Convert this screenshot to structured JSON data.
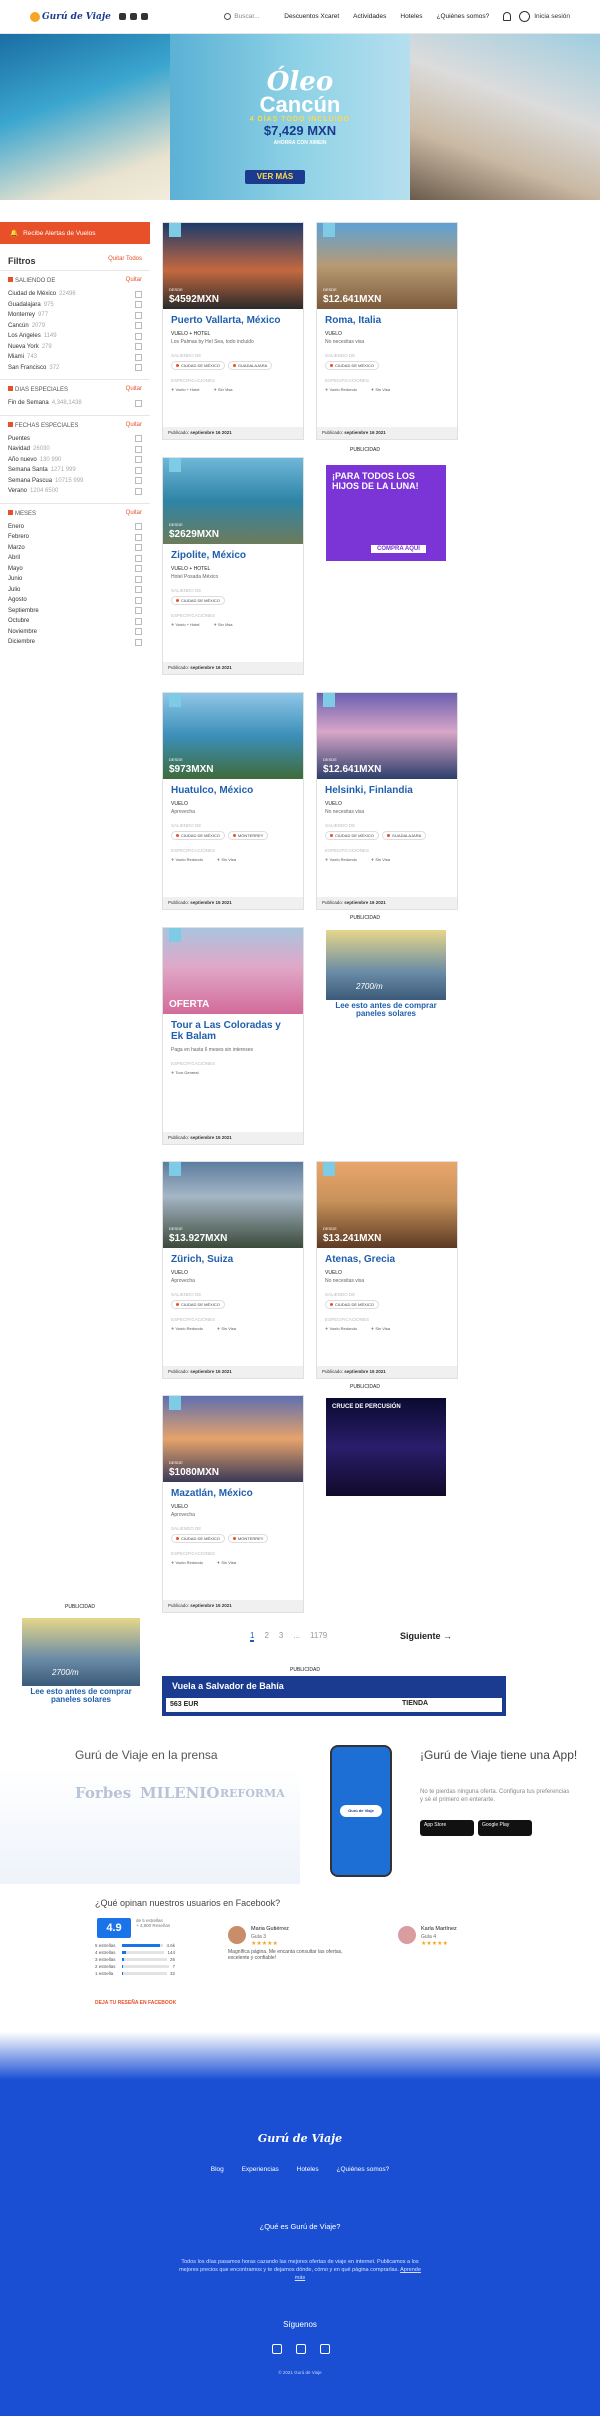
{
  "header": {
    "logo": "Gurú de Viaje",
    "search_placeholder": "Buscar...",
    "nav": [
      "Descuentos Xcaret",
      "Actividades",
      "Hoteles",
      "¿Quiénes somos?"
    ],
    "login": "Inicia sesión"
  },
  "hero": {
    "line1": "Óleo",
    "line2": "Cancún",
    "line3": "4 DÍAS TODO INCLUIDO",
    "price": "$7,429 MXN",
    "note": "AHORRA CON XIMEIN",
    "button": "VER MÁS"
  },
  "sidebar": {
    "alert_button": "Recibe Alertas de Vuelos",
    "filters_title": "Filtros",
    "clear_all": "Quitar Todos",
    "groups": [
      {
        "title": "SALIENDO DE",
        "clear": "Quitar",
        "items": [
          {
            "label": "Ciudad de México",
            "count": "22496"
          },
          {
            "label": "Guadalajara",
            "count": "975"
          },
          {
            "label": "Monterrey",
            "count": "977"
          },
          {
            "label": "Cancún",
            "count": "2079"
          },
          {
            "label": "Los Angeles",
            "count": "1149"
          },
          {
            "label": "Nueva York",
            "count": "279"
          },
          {
            "label": "Miami",
            "count": "743"
          },
          {
            "label": "San Francisco",
            "count": "372"
          }
        ]
      },
      {
        "title": "DIAS ESPECIALES",
        "clear": "Quitar",
        "items": [
          {
            "label": "Fin de Semana",
            "count": "4,348,1438"
          }
        ]
      },
      {
        "title": "FECHAS ESPECIALES",
        "clear": "Quitar",
        "items": [
          {
            "label": "Puentes",
            "count": ""
          },
          {
            "label": "Navidad",
            "count": "26030"
          },
          {
            "label": "Año nuevo",
            "count": "130 990"
          },
          {
            "label": "Semana Santa",
            "count": "1271 999"
          },
          {
            "label": "Semana Pascua",
            "count": "10715 999"
          },
          {
            "label": "Verano",
            "count": "1204 6500"
          }
        ]
      },
      {
        "title": "MESES",
        "clear": "Quitar",
        "items": [
          {
            "label": "Enero",
            "count": ""
          },
          {
            "label": "Febrero",
            "count": ""
          },
          {
            "label": "Marzo",
            "count": ""
          },
          {
            "label": "Abril",
            "count": ""
          },
          {
            "label": "Mayo",
            "count": ""
          },
          {
            "label": "Junio",
            "count": ""
          },
          {
            "label": "Julio",
            "count": ""
          },
          {
            "label": "Agosto",
            "count": ""
          },
          {
            "label": "Septiembre",
            "count": ""
          },
          {
            "label": "Octubre",
            "count": ""
          },
          {
            "label": "Noviembre",
            "count": ""
          },
          {
            "label": "Diciembre",
            "count": ""
          }
        ]
      }
    ]
  },
  "cards": [
    {
      "desde": "DESDE",
      "price": "$4592MXN",
      "title": "Puerto Vallarta, México",
      "sub": "VUELO + HOTEL",
      "desc": "Los Palmas by Hel Sea, todo incluido",
      "saliendo": "SALIENDO DE",
      "pills": [
        "CIUDAD DE MÉXICO",
        "GUADALAJARA"
      ],
      "esp": "ESPECIFICACIONES",
      "ic": [
        "Vuelo + Hotel",
        "Sin Visa"
      ],
      "date_label": "Publicado:",
      "date": "septiembre 16 2021",
      "bg": "linear-gradient(180deg,#1d3a6b 0%,#c4693f 55%,#2a2a2a 100%)"
    },
    {
      "desde": "DESDE",
      "price": "$12.641MXN",
      "title": "Roma, Italia",
      "sub": "VUELO",
      "desc": "No necesitas visa",
      "saliendo": "SALIENDO DE",
      "pills": [
        "CIUDAD DE MÉXICO"
      ],
      "esp": "ESPECIFICACIONES",
      "ic": [
        "Vuelo Redondo",
        "Sin Visa"
      ],
      "date_label": "Publicado:",
      "date": "septiembre 16 2021",
      "bg": "linear-gradient(180deg,#5da2d6 0%,#b89a72 50%,#7b5a3b 100%)"
    },
    {
      "desde": "DESDE",
      "price": "$2629MXN",
      "title": "Zipolite, México",
      "sub": "VUELO + HOTEL",
      "desc": "Hotel Posada México",
      "saliendo": "SALIENDO DE",
      "pills": [
        "CIUDAD DE MÉXICO"
      ],
      "esp": "ESPECIFICACIONES",
      "ic": [
        "Vuelo + Hotel",
        "Sin Visa"
      ],
      "date_label": "Publicado:",
      "date": "septiembre 16 2021",
      "bg": "linear-gradient(180deg,#6fb7d8 0%,#2e84a6 50%,#6d7b5a 100%)"
    },
    {
      "desde": "DESDE",
      "price": "$12.641MXN",
      "title": "Helsinki, Finlandia",
      "sub": "VUELO",
      "desc": "No necesitas visa",
      "saliendo": "SALIENDO DE",
      "pills": [
        "CIUDAD DE MÉXICO",
        "GUADALAJARA"
      ],
      "esp": "ESPECIFICACIONES",
      "ic": [
        "Vuelo Redondo",
        "Sin Visa"
      ],
      "date_label": "Publicado:",
      "date": "septiembre 16 2021",
      "bg": "linear-gradient(180deg,#6b5fb0 0%,#d8a6c8 45%,#2d3e6b 100%)"
    },
    {
      "desde": "DESDE",
      "price": "$973MXN",
      "title": "Huatulco, México",
      "sub": "VUELO",
      "desc": "Aprovecha",
      "saliendo": "SALIENDO DE",
      "pills": [
        "CIUDAD DE MÉXICO",
        "MONTERREY"
      ],
      "esp": "ESPECIFICACIONES",
      "ic": [
        "Vuelo Redondo",
        "Sin Visa"
      ],
      "date_label": "Publicado:",
      "date": "septiembre 15 2021",
      "bg": "linear-gradient(180deg,#8fc6e8 0%,#3b8fb8 50%,#3f6b3a 100%)"
    },
    {
      "desde": "",
      "price": "OFERTA",
      "title": "Tour a Las Coloradas y Ek Balam",
      "sub": "",
      "desc": "Paga en hasta 6 meses sin intereses",
      "saliendo": "",
      "pills": [],
      "esp": "ESPECIFICACIONES",
      "ic": [
        "Tour General"
      ],
      "date_label": "Publicado:",
      "date": "septiembre 15 2021",
      "bg": "linear-gradient(180deg,#a9c4de 0%,#e0a8c8 45%,#d36b9a 100%)"
    },
    {
      "desde": "DESDE",
      "price": "$13.927MXN",
      "title": "Zürich, Suiza",
      "sub": "VUELO",
      "desc": "Aprovecha",
      "saliendo": "SALIENDO DE",
      "pills": [
        "CIUDAD DE MÉXICO"
      ],
      "esp": "ESPECIFICACIONES",
      "ic": [
        "Vuelo Redondo",
        "Sin Visa"
      ],
      "date_label": "Publicado:",
      "date": "septiembre 15 2021",
      "bg": "linear-gradient(180deg,#5d7c9e 0%,#a5b6c6 40%,#3b4a3a 100%)"
    },
    {
      "desde": "DESDE",
      "price": "$13.241MXN",
      "title": "Atenas, Grecia",
      "sub": "VUELO",
      "desc": "No necesitas visa",
      "saliendo": "SALIENDO DE",
      "pills": [
        "CIUDAD DE MÉXICO"
      ],
      "esp": "ESPECIFICACIONES",
      "ic": [
        "Vuelo Redondo",
        "Sin Visa"
      ],
      "date_label": "Publicado:",
      "date": "septiembre 15 2021",
      "bg": "linear-gradient(180deg,#e8a66b 0%,#c9925a 45%,#5c3a24 100%)"
    },
    {
      "desde": "DESDE",
      "price": "$1080MXN",
      "title": "Mazatlán, México",
      "sub": "VUELO",
      "desc": "Aprovecha",
      "saliendo": "SALIENDO DE",
      "pills": [
        "CIUDAD DE MÉXICO",
        "MONTERREY"
      ],
      "esp": "ESPECIFICACIONES",
      "ic": [
        "Vuelo Redondo",
        "Sin Visa"
      ],
      "date_label": "Publicado:",
      "date": "septiembre 15 2021",
      "bg": "linear-gradient(180deg,#5f6fb0 0%,#e6a36a 50%,#3a3a58 100%)"
    }
  ],
  "ads": {
    "publicidad": "PUBLICIDAD",
    "luna_title": "¡PARA TODOS LOS HIJOS DE LA LUNA!",
    "luna_btn": "COMPRA AQUÍ",
    "solar_text": "Lee esto antes de comprar paneles solares",
    "solar_price": "2700/m",
    "show_title": "CRUCE DE PERCUSIÓN",
    "banner_title": "Vuela a Salvador de Bahía",
    "banner_price": "563 EUR",
    "banner_btn": "TIENDA"
  },
  "pagination": {
    "pages": [
      "1",
      "2",
      "3",
      "...",
      "1179"
    ],
    "next": "Siguiente →"
  },
  "press": {
    "title": "Gurú de Viaje en la prensa",
    "brands": [
      "Forbes",
      "MILENIO",
      "REFORMA"
    ],
    "app_title": "¡Gurú de Viaje tiene una App!",
    "app_desc": "No te pierdas ninguna oferta. Configura tus preferencias y sé el primero en enterarte.",
    "appstore": "App Store",
    "googleplay": "Google Play"
  },
  "reviews": {
    "title": "¿Qué opinan nuestros usuarios en Facebook?",
    "score": "4.9",
    "summary1": "de 5 estrellas",
    "summary2": "+ 4,800 Reseñas",
    "bars": [
      {
        "label": "5 estrellas",
        "count": "4.6k",
        "pct": 0.92
      },
      {
        "label": "4 estrellas",
        "count": "144",
        "pct": 0.1
      },
      {
        "label": "3 estrellas",
        "count": "26",
        "pct": 0.04
      },
      {
        "label": "2 estrellas",
        "count": "7",
        "pct": 0.02
      },
      {
        "label": "1 estrella",
        "count": "32",
        "pct": 0.03
      }
    ],
    "link": "DEJA TU RESEÑA EN FACEBOOK",
    "items": [
      {
        "name": "Maria Gutiérrez",
        "sub": "Guía 3",
        "stars": "★★★★★",
        "text": "Magnífica página. Me encanta consultar las ofertas, excelente y confiable!"
      },
      {
        "name": "Karla Martínez",
        "sub": "Guía 4",
        "stars": "★★★★★",
        "text": ""
      }
    ]
  },
  "footer": {
    "logo": "Gurú de Viaje",
    "nav": [
      "Blog",
      "Experiencias",
      "Hoteles",
      "¿Quiénes somos?"
    ],
    "question": "¿Qué es Gurú de Viaje?",
    "desc": "Todos los días pasamos horas cazando las mejores ofertas de viaje en internet. Publicamos a los mejores precios que encontramos y te dejamos dónde, cómo y en qué página comprarlas.",
    "desc_link": "Aprende más",
    "follow": "Síguenos",
    "copy": "© 2021 Gurú de Viaje"
  }
}
